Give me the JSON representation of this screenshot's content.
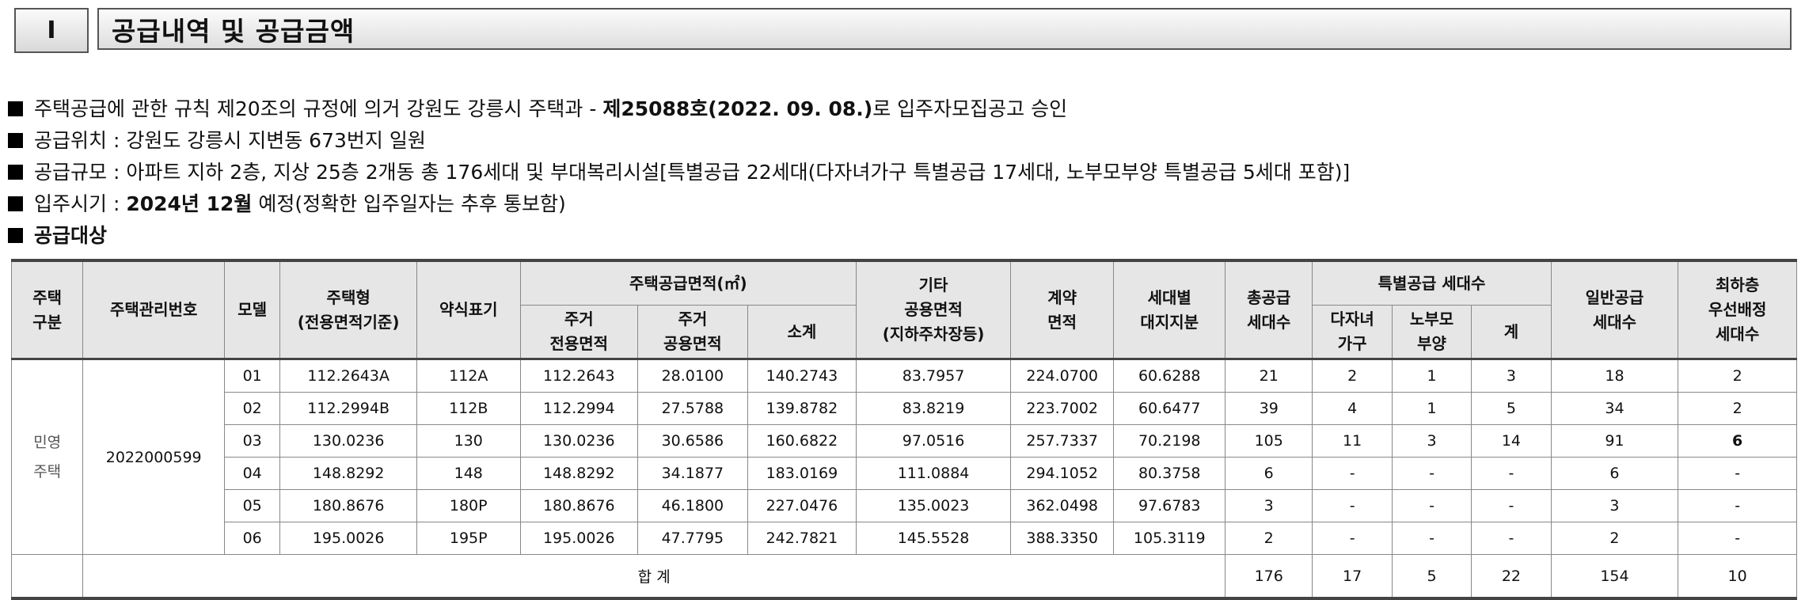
{
  "section": {
    "number": "I",
    "title": "공급내역 및 공급금액"
  },
  "notes": {
    "n1_pre": "주택공급에 관한 규칙 제20조의 규정에 의거 강원도 강릉시 주택과 - ",
    "n1_bold": "제25088호(2022. 09. 08.)",
    "n1_post": "로 입주자모집공고 승인",
    "n2": "공급위치 : 강원도 강릉시 지변동 673번지 일원",
    "n3": "공급규모 : 아파트 지하 2층, 지상 25층 2개동 총 176세대 및 부대복리시설[특별공급 22세대(다자녀가구 특별공급 17세대, 노부모부양 특별공급 5세대 포함)]",
    "n4_pre": "입주시기 : ",
    "n4_bold": "2024년 12월",
    "n4_post": " 예정(정확한 입주일자는 추후 통보함)",
    "n5": "공급대상"
  },
  "table": {
    "headers": {
      "house_type_div": "주택\n구분",
      "mgmt_no": "주택관리번호",
      "model": "모델",
      "house_type": "주택형\n(전용면적기준)",
      "abbr": "약식표기",
      "area_group": "주택공급면적(㎡)",
      "exclusive": "주거\n전용면적",
      "common": "주거\n공용면적",
      "subtotal": "소계",
      "other_common": "기타\n공용면적\n(지하주차장등)",
      "contract_area": "계약\n면적",
      "land_share": "세대별\n대지지분",
      "total_supply": "총공급\n세대수",
      "special_group": "특별공급 세대수",
      "multi_child": "다자녀\n가구",
      "elderly": "노부모\n부양",
      "special_sum": "계",
      "general": "일반공급\n세대수",
      "lowest_floor": "최하층\n우선배정\n세대수"
    },
    "house_type_div_value": "민영\n주택",
    "mgmt_no_value": "2022000599",
    "rows": [
      {
        "model": "01",
        "type": "112.2643A",
        "abbr": "112A",
        "exclusive": "112.2643",
        "common": "28.0100",
        "subtotal": "140.2743",
        "other_common": "83.7957",
        "contract": "224.0700",
        "land": "60.6288",
        "total": "21",
        "multi": "2",
        "elderly": "1",
        "ssum": "3",
        "general": "18",
        "lowest": "2"
      },
      {
        "model": "02",
        "type": "112.2994B",
        "abbr": "112B",
        "exclusive": "112.2994",
        "common": "27.5788",
        "subtotal": "139.8782",
        "other_common": "83.8219",
        "contract": "223.7002",
        "land": "60.6477",
        "total": "39",
        "multi": "4",
        "elderly": "1",
        "ssum": "5",
        "general": "34",
        "lowest": "2"
      },
      {
        "model": "03",
        "type": "130.0236",
        "abbr": "130",
        "exclusive": "130.0236",
        "common": "30.6586",
        "subtotal": "160.6822",
        "other_common": "97.0516",
        "contract": "257.7337",
        "land": "70.2198",
        "total": "105",
        "multi": "11",
        "elderly": "3",
        "ssum": "14",
        "general": "91",
        "lowest": "6"
      },
      {
        "model": "04",
        "type": "148.8292",
        "abbr": "148",
        "exclusive": "148.8292",
        "common": "34.1877",
        "subtotal": "183.0169",
        "other_common": "111.0884",
        "contract": "294.1052",
        "land": "80.3758",
        "total": "6",
        "multi": "-",
        "elderly": "-",
        "ssum": "-",
        "general": "6",
        "lowest": "-"
      },
      {
        "model": "05",
        "type": "180.8676",
        "abbr": "180P",
        "exclusive": "180.8676",
        "common": "46.1800",
        "subtotal": "227.0476",
        "other_common": "135.0023",
        "contract": "362.0498",
        "land": "97.6783",
        "total": "3",
        "multi": "-",
        "elderly": "-",
        "ssum": "-",
        "general": "3",
        "lowest": "-"
      },
      {
        "model": "06",
        "type": "195.0026",
        "abbr": "195P",
        "exclusive": "195.0026",
        "common": "47.7795",
        "subtotal": "242.7821",
        "other_common": "145.5528",
        "contract": "388.3350",
        "land": "105.3119",
        "total": "2",
        "multi": "-",
        "elderly": "-",
        "ssum": "-",
        "general": "2",
        "lowest": "-"
      }
    ],
    "total_row": {
      "label": "합 계",
      "total": "176",
      "multi": "17",
      "elderly": "5",
      "ssum": "22",
      "general": "154",
      "lowest": "10"
    }
  }
}
